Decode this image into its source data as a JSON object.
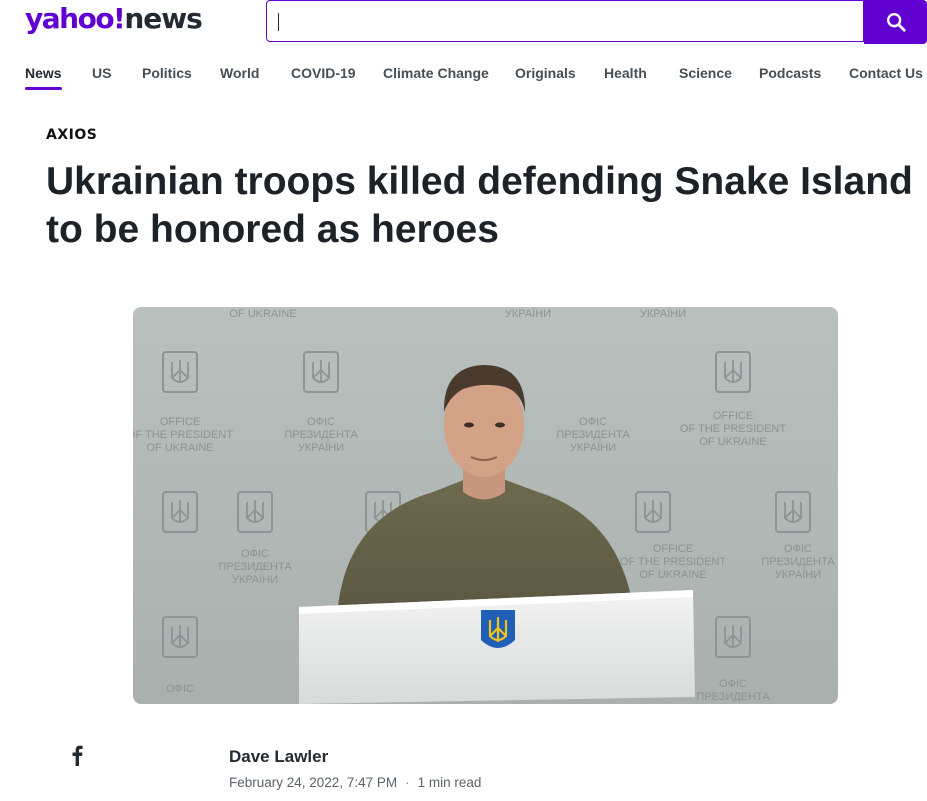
{
  "header": {
    "logo_yahoo": "yahoo!",
    "logo_news": "news",
    "search": {
      "value": "",
      "placeholder": ""
    },
    "search_button_icon": "search-icon",
    "brand_color": "#6001d2"
  },
  "nav": {
    "items": [
      {
        "label": "News",
        "active": true
      },
      {
        "label": "US"
      },
      {
        "label": "Politics"
      },
      {
        "label": "World"
      },
      {
        "label": "COVID-19"
      },
      {
        "label": "Climate Change"
      },
      {
        "label": "Originals"
      },
      {
        "label": "Health"
      },
      {
        "label": "Science"
      },
      {
        "label": "Podcasts"
      },
      {
        "label": "Contact Us"
      }
    ]
  },
  "article": {
    "source": "AXIOS",
    "headline": "Ukrainian troops killed defending Snake Island to be honored as heroes",
    "hero_image": {
      "backdrop_text_en": "OFFICE OF THE PRESIDENT OF UKRAINE",
      "backdrop_text_ua": "ОФІС ПРЕЗИДЕНТА УКРАЇНИ"
    },
    "share_icon": "facebook-icon",
    "author": "Dave Lawler",
    "date": "February 24, 2022, 7:47 PM",
    "separator": "·",
    "read_time": "1 min read"
  }
}
